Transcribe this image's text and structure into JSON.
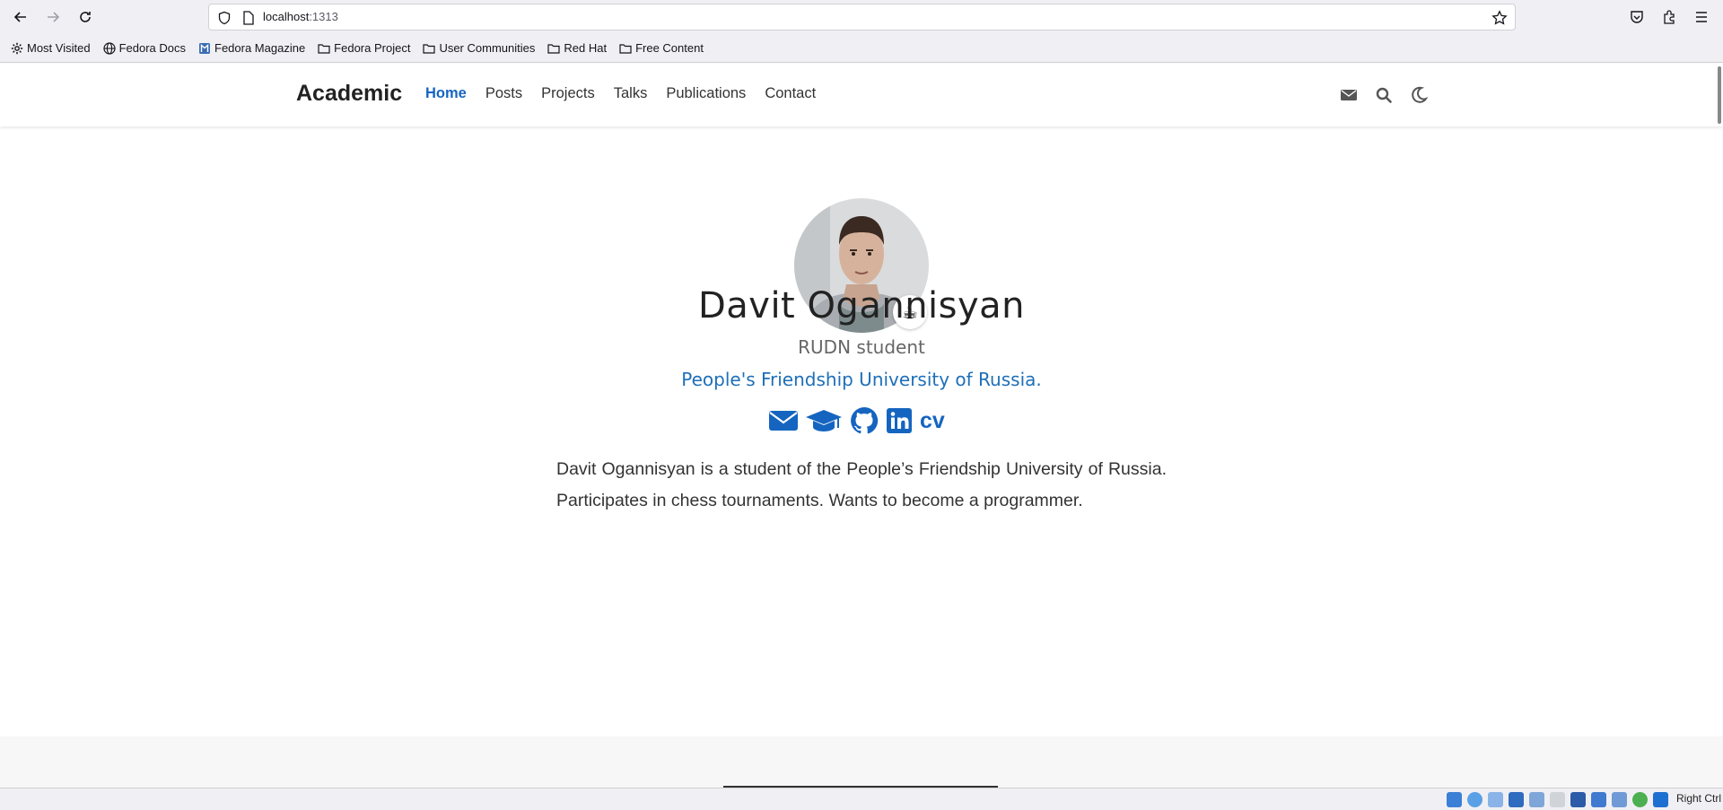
{
  "browser": {
    "url_host": "localhost",
    "url_port": ":1313",
    "bookmarks": [
      {
        "label": "Most Visited",
        "icon": "gear-icon"
      },
      {
        "label": "Fedora Docs",
        "icon": "globe-icon"
      },
      {
        "label": "Fedora Magazine",
        "icon": "fedora-magazine-icon"
      },
      {
        "label": "Fedora Project",
        "icon": "folder-icon"
      },
      {
        "label": "User Communities",
        "icon": "folder-icon"
      },
      {
        "label": "Red Hat",
        "icon": "folder-icon"
      },
      {
        "label": "Free Content",
        "icon": "folder-icon"
      }
    ]
  },
  "site": {
    "brand": "Academic",
    "nav": [
      "Home",
      "Posts",
      "Projects",
      "Talks",
      "Publications",
      "Contact"
    ],
    "active_nav": "Home",
    "header_icons": [
      "envelope-icon",
      "search-icon",
      "moon-icon"
    ]
  },
  "profile": {
    "avatar_emoji": "☕",
    "name": "Davit Ogannisyan",
    "role": "RUDN student",
    "organization": "People's Friendship University of Russia.",
    "social_icons": [
      "envelope-icon",
      "graduation-cap-icon",
      "github-icon",
      "linkedin-icon"
    ],
    "cv_label": "cv",
    "bio": "Davit Ogannisyan is a student of the People’s Friendship University of Russia. Participates in chess tournaments. Wants to become a programmer."
  },
  "statusbar": {
    "host_key": "Right Ctrl"
  },
  "colors": {
    "accent": "#1565c0",
    "org_link": "#1e6fb8"
  }
}
